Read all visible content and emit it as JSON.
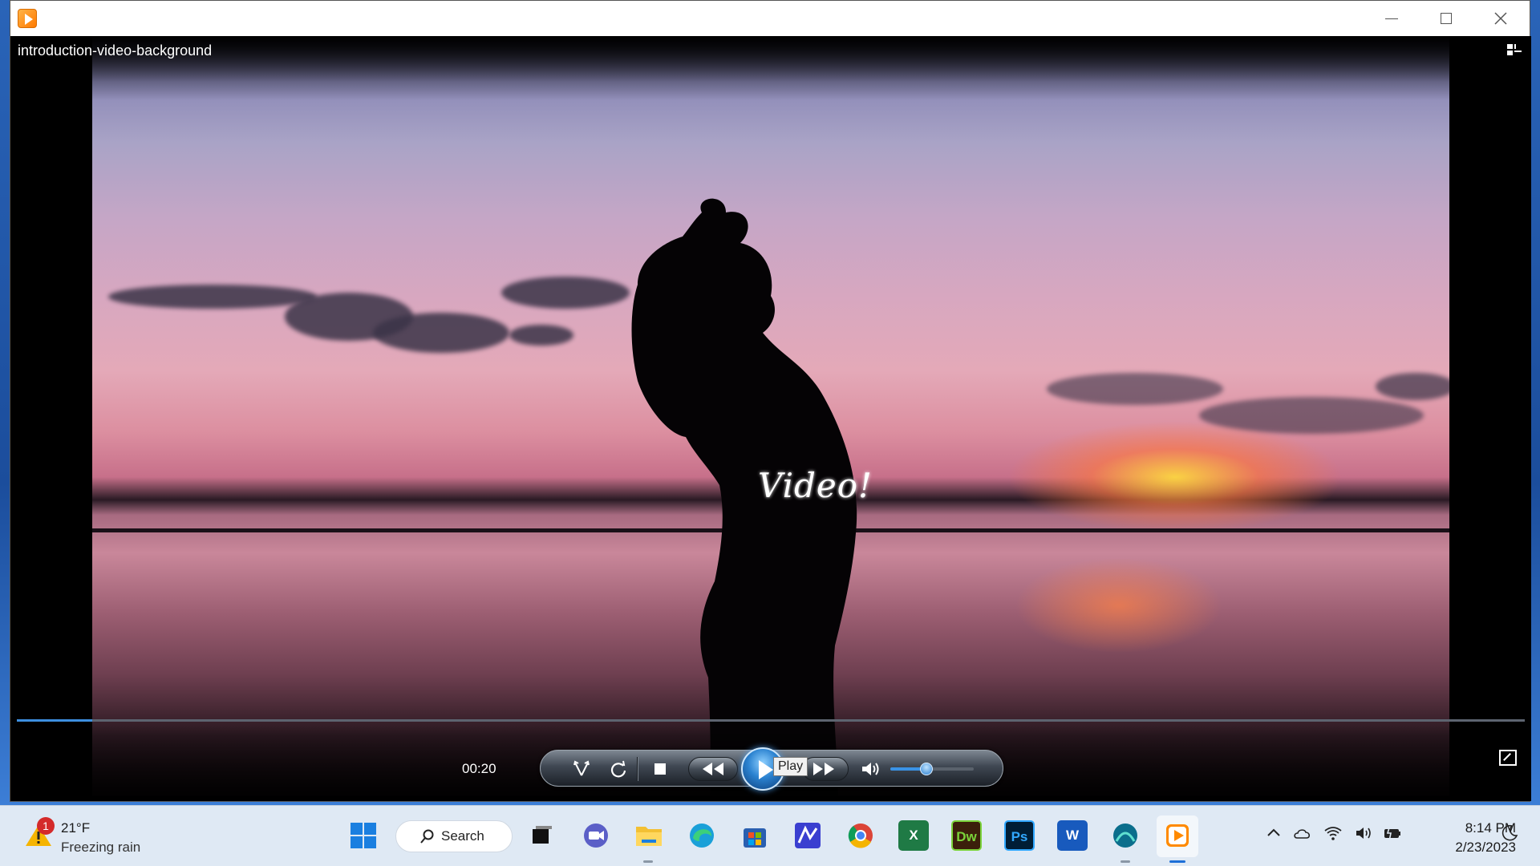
{
  "window": {
    "video_title": "introduction-video-background"
  },
  "video": {
    "overlay_text": "Video!",
    "elapsed": "00:20",
    "progress_fraction": 0.05
  },
  "controls": {
    "play_tooltip": "Play",
    "volume_level": 0.43,
    "icons": [
      "shuffle-icon",
      "repeat-icon",
      "stop-icon",
      "previous-icon",
      "play-icon",
      "next-icon",
      "volume-icon",
      "fullscreen-icon"
    ]
  },
  "taskbar": {
    "weather": {
      "badge": "1",
      "temperature": "21°F",
      "description": "Freezing rain"
    },
    "search_label": "Search",
    "apps": [
      {
        "name": "task-view",
        "label": ""
      },
      {
        "name": "meet",
        "label": ""
      },
      {
        "name": "file-explorer",
        "label": ""
      },
      {
        "name": "edge",
        "label": ""
      },
      {
        "name": "store",
        "label": ""
      },
      {
        "name": "app-m",
        "label": ""
      },
      {
        "name": "chrome",
        "label": ""
      },
      {
        "name": "excel",
        "label": "X"
      },
      {
        "name": "dreamweaver",
        "label": "Dw"
      },
      {
        "name": "photoshop",
        "label": "Ps"
      },
      {
        "name": "word",
        "label": "W"
      },
      {
        "name": "media-app",
        "label": ""
      },
      {
        "name": "media-player",
        "label": ""
      }
    ],
    "clock": {
      "time": "8:14 PM",
      "date": "2/23/2023"
    }
  },
  "colors": {
    "accent": "#1d6fd8",
    "excel": "#1f7a45",
    "dreamweaver": "#3b1f0b",
    "photoshop": "#001e36",
    "word": "#185abd"
  }
}
